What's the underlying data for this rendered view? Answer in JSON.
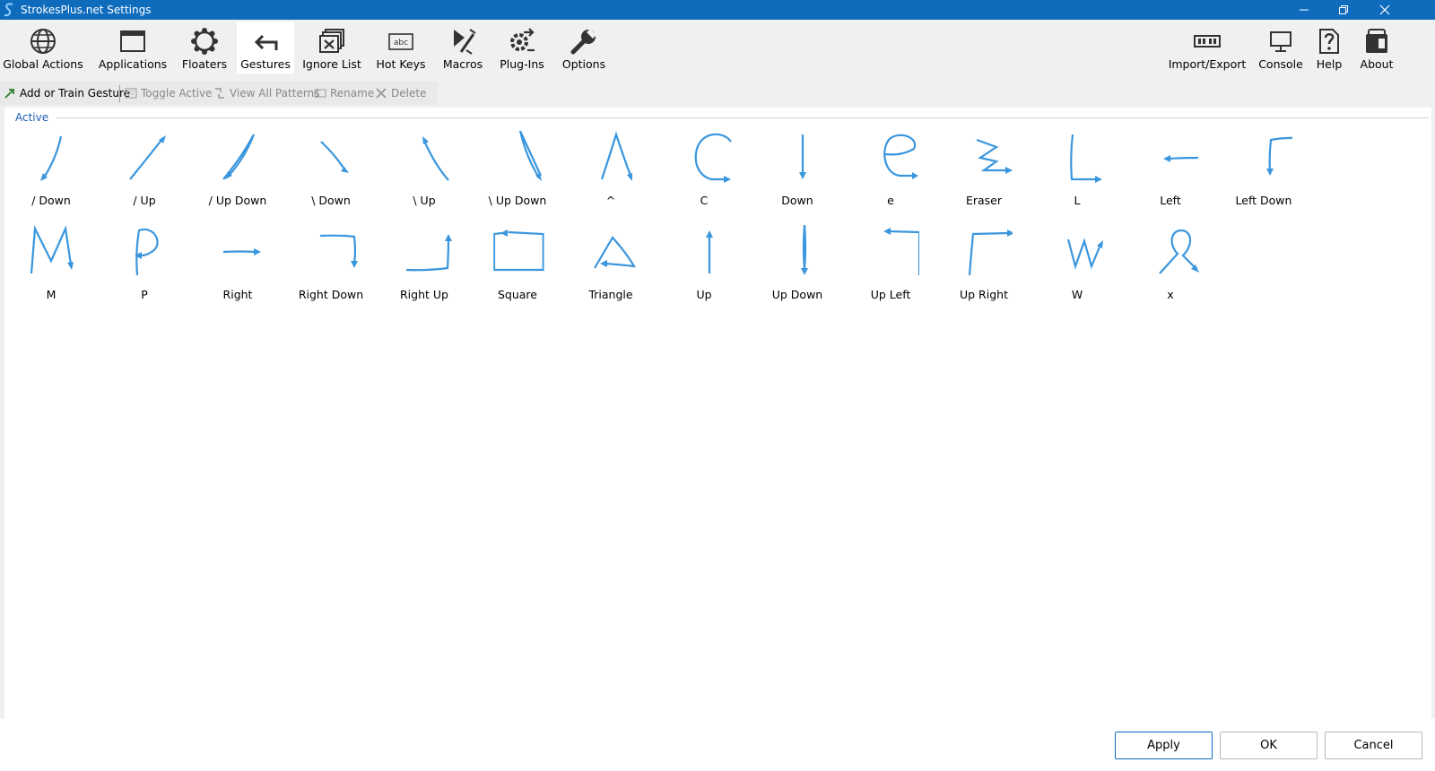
{
  "window": {
    "title": "StrokesPlus.net Settings"
  },
  "toolbar": {
    "left": [
      {
        "label": "Global Actions",
        "icon": "globe-icon"
      },
      {
        "label": "Applications",
        "icon": "window-icon"
      },
      {
        "label": "Floaters",
        "icon": "floaters-icon"
      },
      {
        "label": "Gestures",
        "icon": "gesture-arrow-icon",
        "selected": true
      },
      {
        "label": "Ignore List",
        "icon": "ignore-list-icon"
      },
      {
        "label": "Hot Keys",
        "icon": "hotkeys-icon"
      },
      {
        "label": "Macros",
        "icon": "macros-icon"
      },
      {
        "label": "Plug-Ins",
        "icon": "plugins-icon"
      },
      {
        "label": "Options",
        "icon": "wrench-icon"
      }
    ],
    "right": [
      {
        "label": "Import/Export",
        "icon": "import-export-icon"
      },
      {
        "label": "Console",
        "icon": "console-icon"
      },
      {
        "label": "Help",
        "icon": "help-icon"
      },
      {
        "label": "About",
        "icon": "about-icon"
      }
    ]
  },
  "subtoolbar": {
    "add": "Add or Train Gesture",
    "toggle": "Toggle Active",
    "view_all": "View All Patterns",
    "rename": "Rename",
    "delete": "Delete"
  },
  "group": {
    "label": "Active"
  },
  "gestures_row1": [
    {
      "label": "/ Down",
      "icon": "slash-down-gesture-icon"
    },
    {
      "label": "/ Up",
      "icon": "slash-up-gesture-icon"
    },
    {
      "label": "/ Up Down",
      "icon": "slash-up-down-gesture-icon"
    },
    {
      "label": "\\ Down",
      "icon": "backslash-down-gesture-icon"
    },
    {
      "label": "\\ Up",
      "icon": "backslash-up-gesture-icon"
    },
    {
      "label": "\\ Up Down",
      "icon": "backslash-up-down-gesture-icon"
    },
    {
      "label": "^",
      "icon": "caret-gesture-icon"
    },
    {
      "label": "C",
      "icon": "c-gesture-icon"
    },
    {
      "label": "Down",
      "icon": "down-gesture-icon"
    },
    {
      "label": "e",
      "icon": "e-gesture-icon"
    },
    {
      "label": "Eraser",
      "icon": "eraser-gesture-icon"
    },
    {
      "label": "L",
      "icon": "l-gesture-icon"
    },
    {
      "label": "Left",
      "icon": "left-gesture-icon"
    },
    {
      "label": "Left Down",
      "icon": "left-down-gesture-icon"
    }
  ],
  "gestures_row2": [
    {
      "label": "M",
      "icon": "m-gesture-icon"
    },
    {
      "label": "P",
      "icon": "p-gesture-icon"
    },
    {
      "label": "Right",
      "icon": "right-gesture-icon"
    },
    {
      "label": "Right Down",
      "icon": "right-down-gesture-icon"
    },
    {
      "label": "Right Up",
      "icon": "right-up-gesture-icon"
    },
    {
      "label": "Square",
      "icon": "square-gesture-icon"
    },
    {
      "label": "Triangle",
      "icon": "triangle-gesture-icon"
    },
    {
      "label": "Up",
      "icon": "up-gesture-icon"
    },
    {
      "label": "Up Down",
      "icon": "up-down-gesture-icon"
    },
    {
      "label": "Up Left",
      "icon": "up-left-gesture-icon"
    },
    {
      "label": "Up Right",
      "icon": "up-right-gesture-icon"
    },
    {
      "label": "W",
      "icon": "w-gesture-icon"
    },
    {
      "label": "x",
      "icon": "x-gesture-icon"
    }
  ],
  "buttons": {
    "apply": "Apply",
    "ok": "OK",
    "cancel": "Cancel"
  },
  "colors": {
    "titlebar": "#0f6cbd",
    "stroke": "#3a96dd",
    "group_label": "#1f5fb5"
  }
}
